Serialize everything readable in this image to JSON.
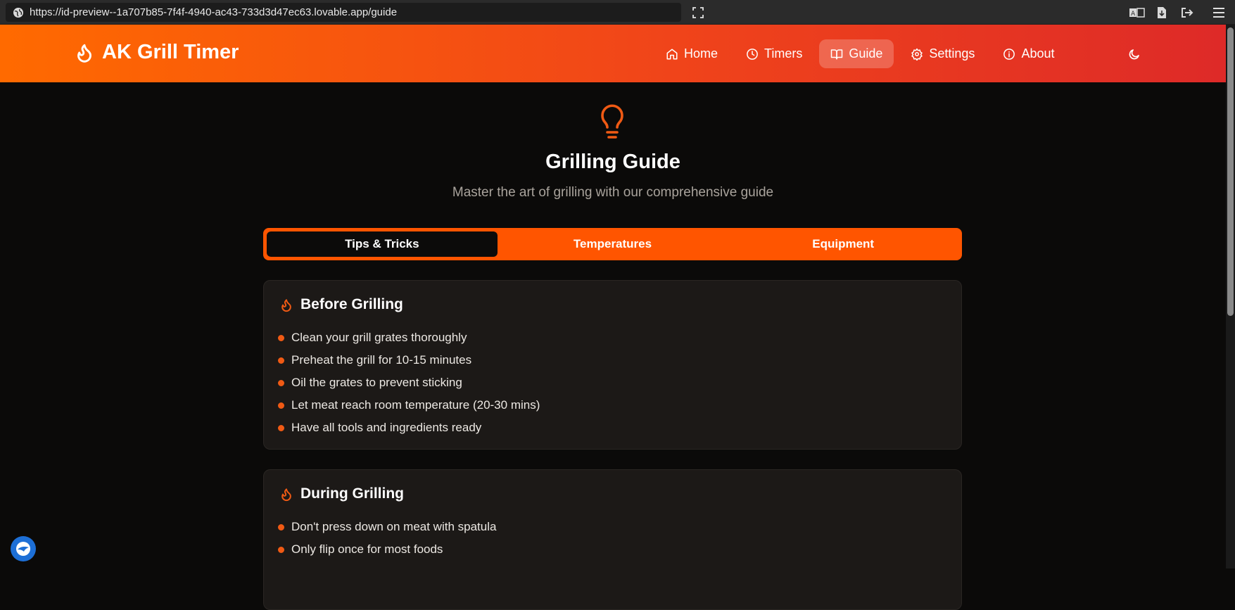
{
  "browser": {
    "url": "https://id-preview--1a707b85-7f4f-4940-ac43-733d3d47ec63.lovable.app/guide",
    "icons": [
      "globe-icon",
      "fullscreen-icon",
      "translate-icon",
      "download-icon",
      "logout-icon",
      "menu-icon"
    ]
  },
  "header": {
    "brand": "AK Grill Timer",
    "brand_icon": "flame-icon",
    "nav": [
      {
        "label": "Home",
        "icon": "home-icon"
      },
      {
        "label": "Timers",
        "icon": "clock-icon"
      },
      {
        "label": "Guide",
        "icon": "book-icon",
        "active": true
      },
      {
        "label": "Settings",
        "icon": "gear-icon"
      },
      {
        "label": "About",
        "icon": "info-icon"
      }
    ],
    "theme_icon": "moon-icon"
  },
  "hero": {
    "icon": "lightbulb-icon",
    "title": "Grilling Guide",
    "subtitle": "Master the art of grilling with our comprehensive guide"
  },
  "tabs": [
    {
      "label": "Tips & Tricks",
      "active": true
    },
    {
      "label": "Temperatures"
    },
    {
      "label": "Equipment"
    }
  ],
  "cards": [
    {
      "title": "Before Grilling",
      "items": [
        "Clean your grill grates thoroughly",
        "Preheat the grill for 10-15 minutes",
        "Oil the grates to prevent sticking",
        "Let meat reach room temperature (20-30 mins)",
        "Have all tools and ingredients ready"
      ]
    },
    {
      "title": "During Grilling",
      "items": [
        "Don't press down on meat with spatula",
        "Only flip once for most foods"
      ]
    }
  ],
  "colors": {
    "accent": "#ff5500",
    "header_start": "#ff6a00",
    "header_end": "#de2a28",
    "background": "#0b0a09",
    "card": "#1c1917"
  }
}
